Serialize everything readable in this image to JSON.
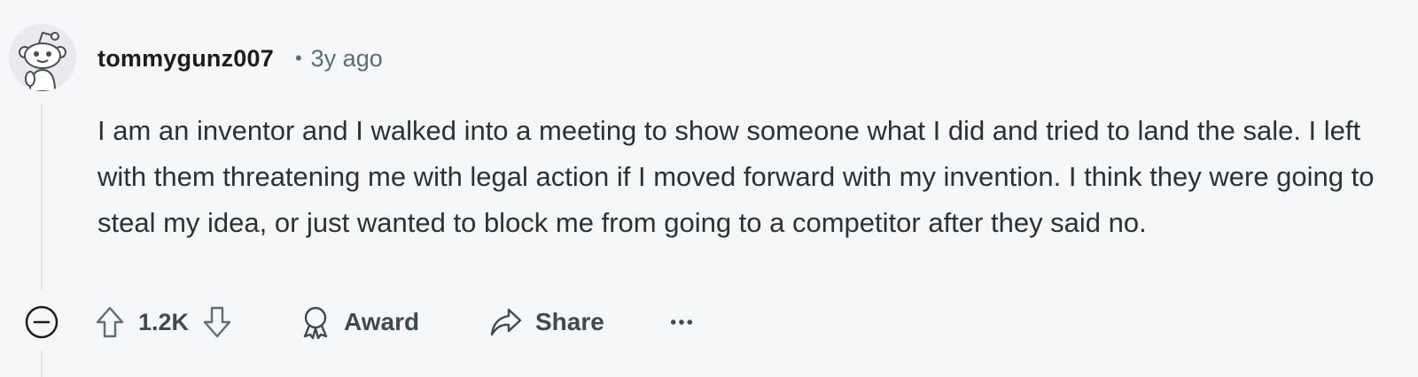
{
  "comment": {
    "author": "tommygunz007",
    "separator": "•",
    "age": "3y ago",
    "body": "I am an inventor and I walked into a meeting to show someone what I did and tried to land the sale. I left with them threatening me with legal action if I moved forward with my invention. I think they were going to steal my idea, or just wanted to block me from going to a competitor after they said no.",
    "score": "1.2K",
    "award_label": "Award",
    "share_label": "Share",
    "more_label": "•••"
  },
  "icons": {
    "avatar": "snoo-avatar",
    "collapse": "collapse-minus-icon",
    "upvote": "arrow-up-icon",
    "downvote": "arrow-down-icon",
    "award": "award-ribbon-icon",
    "share": "share-arrow-icon"
  },
  "colors": {
    "background": "#f6f7f8",
    "text": "#2a3236",
    "muted": "#576f76",
    "action": "#3c4a52"
  }
}
